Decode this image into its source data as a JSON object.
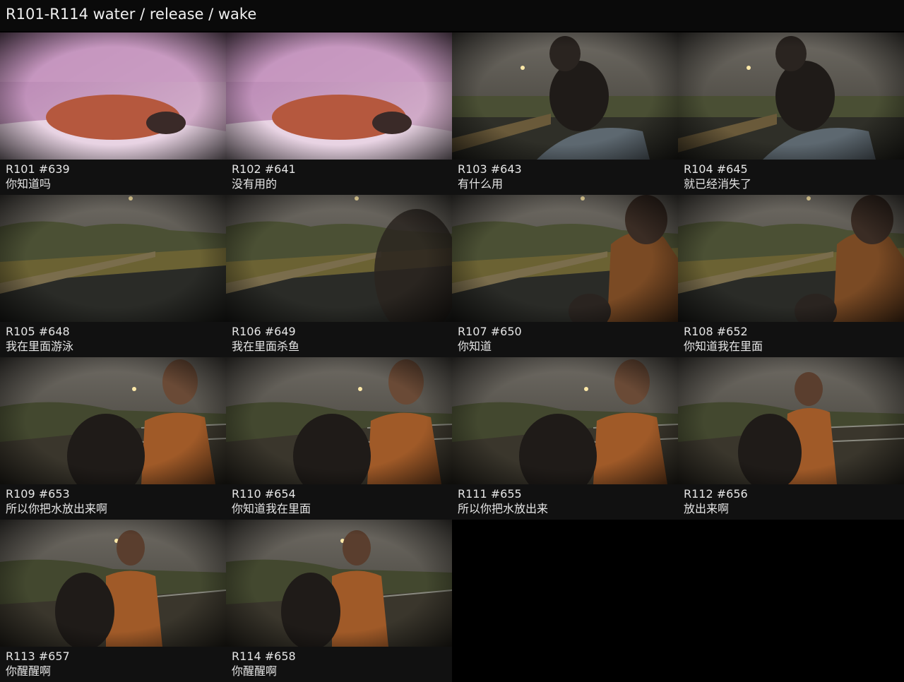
{
  "title": "R101-R114 water / release / wake",
  "frames": [
    {
      "id": "R101 #639",
      "text": "你知道吗",
      "scene": "bedroom"
    },
    {
      "id": "R102 #641",
      "text": "没有用的",
      "scene": "bedroom"
    },
    {
      "id": "R103 #643",
      "text": "有什么用",
      "scene": "night-head"
    },
    {
      "id": "R104 #645",
      "text": "就已经消失了",
      "scene": "night-head"
    },
    {
      "id": "R105 #648",
      "text": "我在里面游泳",
      "scene": "riverbank"
    },
    {
      "id": "R106 #649",
      "text": "我在里面杀鱼",
      "scene": "riverbank-blur"
    },
    {
      "id": "R107 #650",
      "text": "你知道",
      "scene": "riverbank-person"
    },
    {
      "id": "R108 #652",
      "text": "你知道我在里面",
      "scene": "riverbank-person"
    },
    {
      "id": "R109 #653",
      "text": "所以你把水放出来啊",
      "scene": "boy-railing"
    },
    {
      "id": "R110 #654",
      "text": "你知道我在里面",
      "scene": "boy-railing"
    },
    {
      "id": "R111 #655",
      "text": "所以你把水放出来",
      "scene": "boy-railing"
    },
    {
      "id": "R112 #656",
      "text": "放出来啊",
      "scene": "boy-railing-far"
    },
    {
      "id": "R113 #657",
      "text": "你醒醒啊",
      "scene": "boy-sitting"
    },
    {
      "id": "R114 #658",
      "text": "你醒醒啊",
      "scene": "boy-sitting"
    }
  ]
}
